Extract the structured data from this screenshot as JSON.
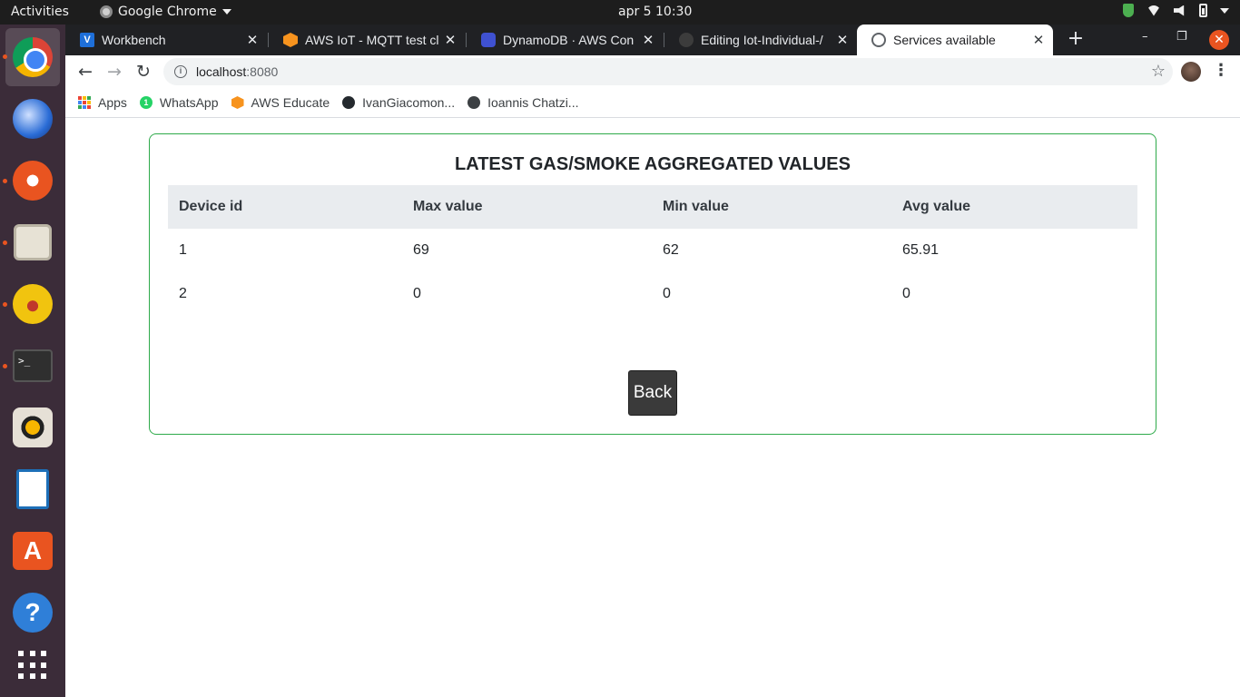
{
  "topbar": {
    "activities": "Activities",
    "app_name": "Google Chrome",
    "clock": "apr 5  10:30"
  },
  "dock": {
    "items": [
      "chrome-icon",
      "thunderbird-icon",
      "inkscape-icon",
      "files-icon",
      "teapot-icon",
      "terminal-icon",
      "rhythmbox-icon",
      "writer-icon",
      "software-store-icon",
      "help-icon",
      "show-apps-icon"
    ],
    "terminal_glyph": ">_",
    "store_glyph": "A",
    "help_glyph": "?"
  },
  "tabs": [
    {
      "title": "Workbench",
      "icon": "V"
    },
    {
      "title": "AWS IoT - MQTT test cl",
      "icon": "aws"
    },
    {
      "title": "DynamoDB · AWS Con",
      "icon": "db"
    },
    {
      "title": "Editing Iot-Individual-/",
      "icon": "github"
    },
    {
      "title": "Services available",
      "icon": "globe"
    }
  ],
  "window_controls": {
    "minimize": "–",
    "restore": "❐",
    "close": "✕"
  },
  "toolbar": {
    "url_host": "localhost",
    "url_port": ":8080"
  },
  "bookmarks": [
    {
      "label": "Apps"
    },
    {
      "label": "WhatsApp"
    },
    {
      "label": "AWS Educate"
    },
    {
      "label": "IvanGiacomon..."
    },
    {
      "label": "Ioannis Chatzi..."
    }
  ],
  "page": {
    "title": "LATEST GAS/SMOKE AGGREGATED VALUES",
    "columns": [
      "Device id",
      "Max value",
      "Min value",
      "Avg value"
    ],
    "rows": [
      [
        "1",
        "69",
        "62",
        "65.91"
      ],
      [
        "2",
        "0",
        "0",
        "0"
      ]
    ],
    "back_label": "Back"
  },
  "colors": {
    "card_border": "#2eaa4a",
    "header_bg": "#e9ecef",
    "button_bg": "#3a3a3a",
    "dock_bg": "#3b2c39",
    "tabstrip_bg": "#202124"
  }
}
